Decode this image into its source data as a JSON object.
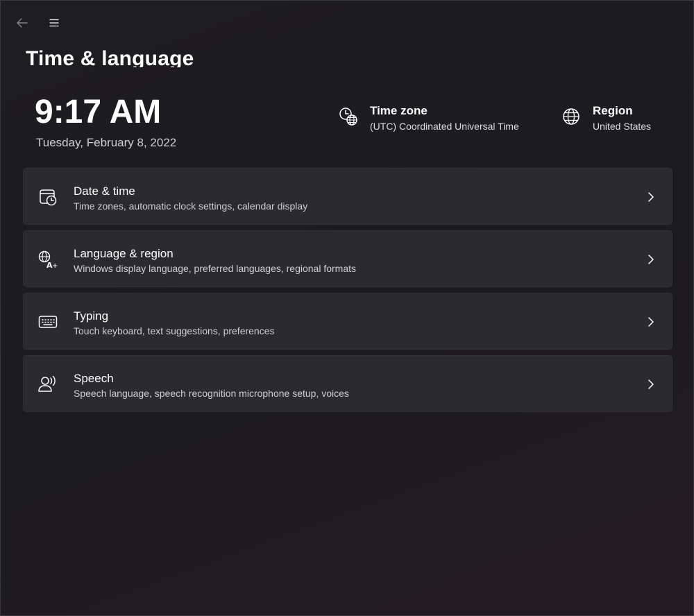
{
  "window": {
    "page_title": "Time & language"
  },
  "topbar": {
    "back_icon": "back-arrow-icon",
    "menu_icon": "hamburger-menu-icon"
  },
  "clock": {
    "time": "9:17 AM",
    "date": "Tuesday, February 8, 2022"
  },
  "time_zone": {
    "icon": "clock-globe-icon",
    "title": "Time zone",
    "value": "(UTC) Coordinated Universal Time"
  },
  "region": {
    "icon": "globe-icon",
    "title": "Region",
    "value": "United States"
  },
  "cards": [
    {
      "icon": "calendar-clock-icon",
      "title": "Date & time",
      "subtitle": "Time zones, automatic clock settings, calendar display"
    },
    {
      "icon": "language-icon",
      "title": "Language & region",
      "subtitle": "Windows display language, preferred languages, regional formats"
    },
    {
      "icon": "keyboard-icon",
      "title": "Typing",
      "subtitle": "Touch keyboard, text suggestions, preferences"
    },
    {
      "icon": "speech-icon",
      "title": "Speech",
      "subtitle": "Speech language, speech recognition microphone setup, voices"
    }
  ],
  "colors": {
    "background": "#1c1b1f",
    "card": "#2b2a2e",
    "text_primary": "#ffffff",
    "text_secondary": "#cfcfd3"
  }
}
